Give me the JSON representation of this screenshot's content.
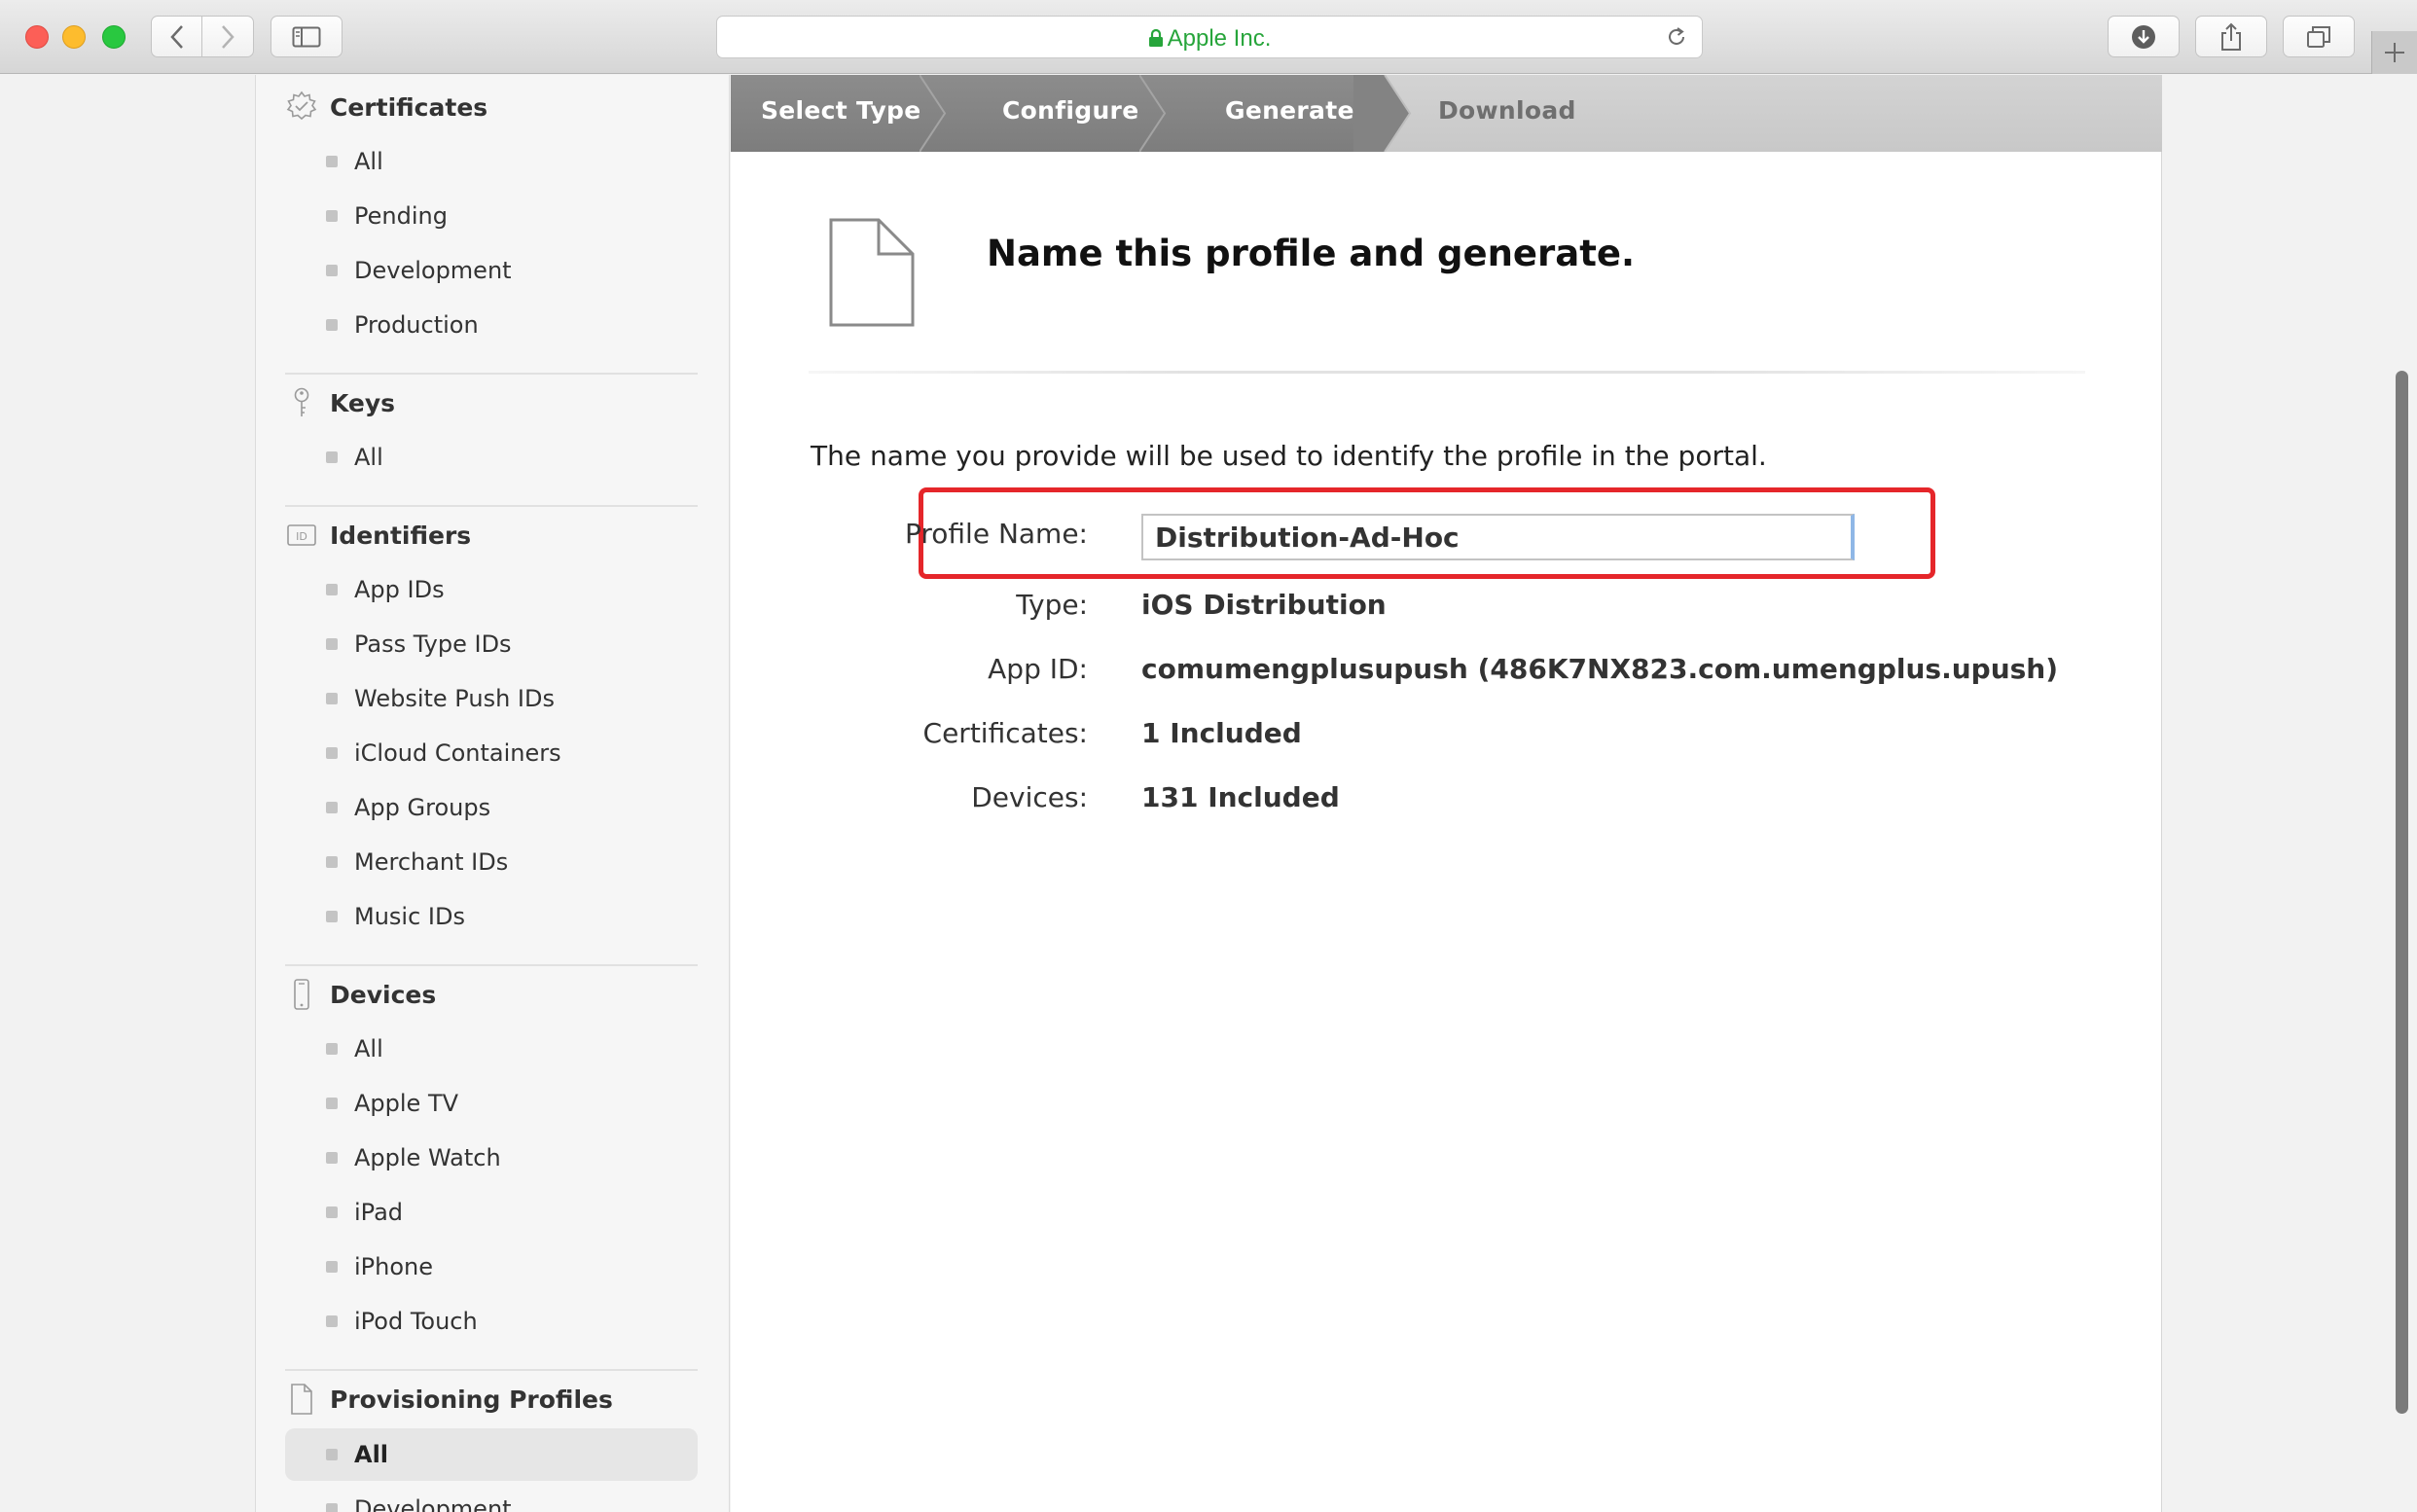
{
  "browser": {
    "address_text": "Apple Inc.",
    "accent": "#27a53b"
  },
  "sidebar": {
    "sections": [
      {
        "title": "Certificates",
        "icon": "certificate-icon",
        "items": [
          "All",
          "Pending",
          "Development",
          "Production"
        ]
      },
      {
        "title": "Keys",
        "icon": "key-icon",
        "items": [
          "All"
        ]
      },
      {
        "title": "Identifiers",
        "icon": "id-icon",
        "items": [
          "App IDs",
          "Pass Type IDs",
          "Website Push IDs",
          "iCloud Containers",
          "App Groups",
          "Merchant IDs",
          "Music IDs"
        ]
      },
      {
        "title": "Devices",
        "icon": "device-icon",
        "items": [
          "All",
          "Apple TV",
          "Apple Watch",
          "iPad",
          "iPhone",
          "iPod Touch"
        ]
      },
      {
        "title": "Provisioning Profiles",
        "icon": "document-icon",
        "items": [
          "All",
          "Development"
        ]
      }
    ],
    "active_item": "Provisioning Profiles / All"
  },
  "steps": [
    "Select Type",
    "Configure",
    "Generate",
    "Download"
  ],
  "main": {
    "title": "Name this profile and generate.",
    "intro": "The name you provide will be used to identify the profile in the portal.",
    "profile_name_label": "Profile Name:",
    "profile_name_value": "Distribution-Ad-Hoc",
    "type_label": "Type:",
    "type_value": "iOS Distribution",
    "app_id_label": "App ID:",
    "app_id_value": "comumengplusupush (486K7NX823.com.umengplus.upush)",
    "certificates_label": "Certificates:",
    "certificates_value": "1 Included",
    "devices_label": "Devices:",
    "devices_value": "131 Included"
  },
  "colors": {
    "highlight": "#e5262a",
    "step_active": "#858585",
    "step_inactive": "#cfcfcf"
  }
}
